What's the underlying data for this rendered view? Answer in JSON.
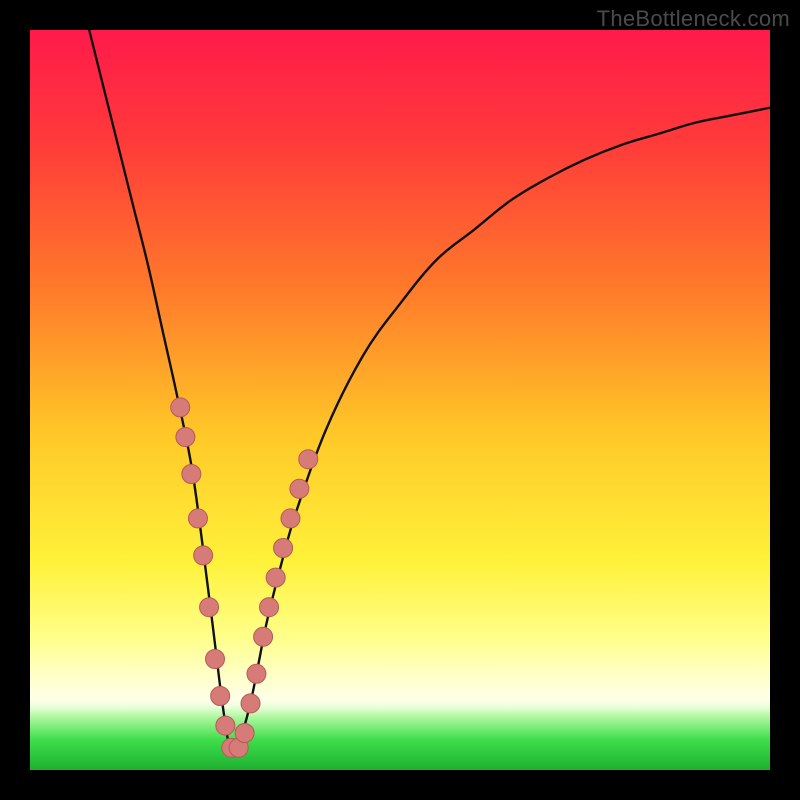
{
  "watermark": {
    "text": "TheBottleneck.com"
  },
  "colors": {
    "frame": "#000000",
    "curve": "#111111",
    "marker_fill": "#d77b78",
    "marker_stroke": "#b55a57",
    "green_band": "#2ecc40",
    "gradient_stops": [
      {
        "offset": 0.0,
        "color": "#ff1a4b"
      },
      {
        "offset": 0.15,
        "color": "#ff3a3a"
      },
      {
        "offset": 0.35,
        "color": "#ff7a2a"
      },
      {
        "offset": 0.55,
        "color": "#ffc928"
      },
      {
        "offset": 0.72,
        "color": "#fff23a"
      },
      {
        "offset": 0.82,
        "color": "#ffff8a"
      },
      {
        "offset": 0.88,
        "color": "#ffffd0"
      },
      {
        "offset": 0.905,
        "color": "#ffffe8"
      },
      {
        "offset": 0.915,
        "color": "#e8ffd8"
      },
      {
        "offset": 0.93,
        "color": "#a8f79a"
      },
      {
        "offset": 0.96,
        "color": "#3ddc4a"
      },
      {
        "offset": 1.0,
        "color": "#1eb030"
      }
    ]
  },
  "chart_data": {
    "type": "line",
    "title": "",
    "xlabel": "",
    "ylabel": "",
    "xlim": [
      0,
      100
    ],
    "ylim": [
      0,
      100
    ],
    "x_optimum": 27,
    "series": [
      {
        "name": "bottleneck-curve",
        "x": [
          8,
          10,
          12,
          14,
          16,
          18,
          20,
          22,
          24,
          25,
          26,
          27,
          28,
          29,
          30,
          31,
          32,
          34,
          36,
          40,
          45,
          50,
          55,
          60,
          65,
          70,
          75,
          80,
          85,
          90,
          95,
          100
        ],
        "y": [
          100,
          92,
          84,
          76,
          68,
          59,
          50,
          40,
          25,
          17,
          9,
          3,
          3,
          6,
          10,
          15,
          20,
          28,
          35,
          46,
          56,
          63,
          69,
          73,
          77,
          80,
          82.5,
          84.5,
          86,
          87.5,
          88.5,
          89.5
        ]
      }
    ],
    "markers": {
      "name": "highlighted-points",
      "points": [
        {
          "x": 20.3,
          "y": 49
        },
        {
          "x": 21.0,
          "y": 45
        },
        {
          "x": 21.8,
          "y": 40
        },
        {
          "x": 22.7,
          "y": 34
        },
        {
          "x": 23.4,
          "y": 29
        },
        {
          "x": 24.2,
          "y": 22
        },
        {
          "x": 25.0,
          "y": 15
        },
        {
          "x": 25.7,
          "y": 10
        },
        {
          "x": 26.4,
          "y": 6
        },
        {
          "x": 27.2,
          "y": 3
        },
        {
          "x": 28.2,
          "y": 3
        },
        {
          "x": 29.0,
          "y": 5
        },
        {
          "x": 29.8,
          "y": 9
        },
        {
          "x": 30.6,
          "y": 13
        },
        {
          "x": 31.5,
          "y": 18
        },
        {
          "x": 32.3,
          "y": 22
        },
        {
          "x": 33.2,
          "y": 26
        },
        {
          "x": 34.2,
          "y": 30
        },
        {
          "x": 35.2,
          "y": 34
        },
        {
          "x": 36.4,
          "y": 38
        },
        {
          "x": 37.6,
          "y": 42
        }
      ]
    }
  }
}
